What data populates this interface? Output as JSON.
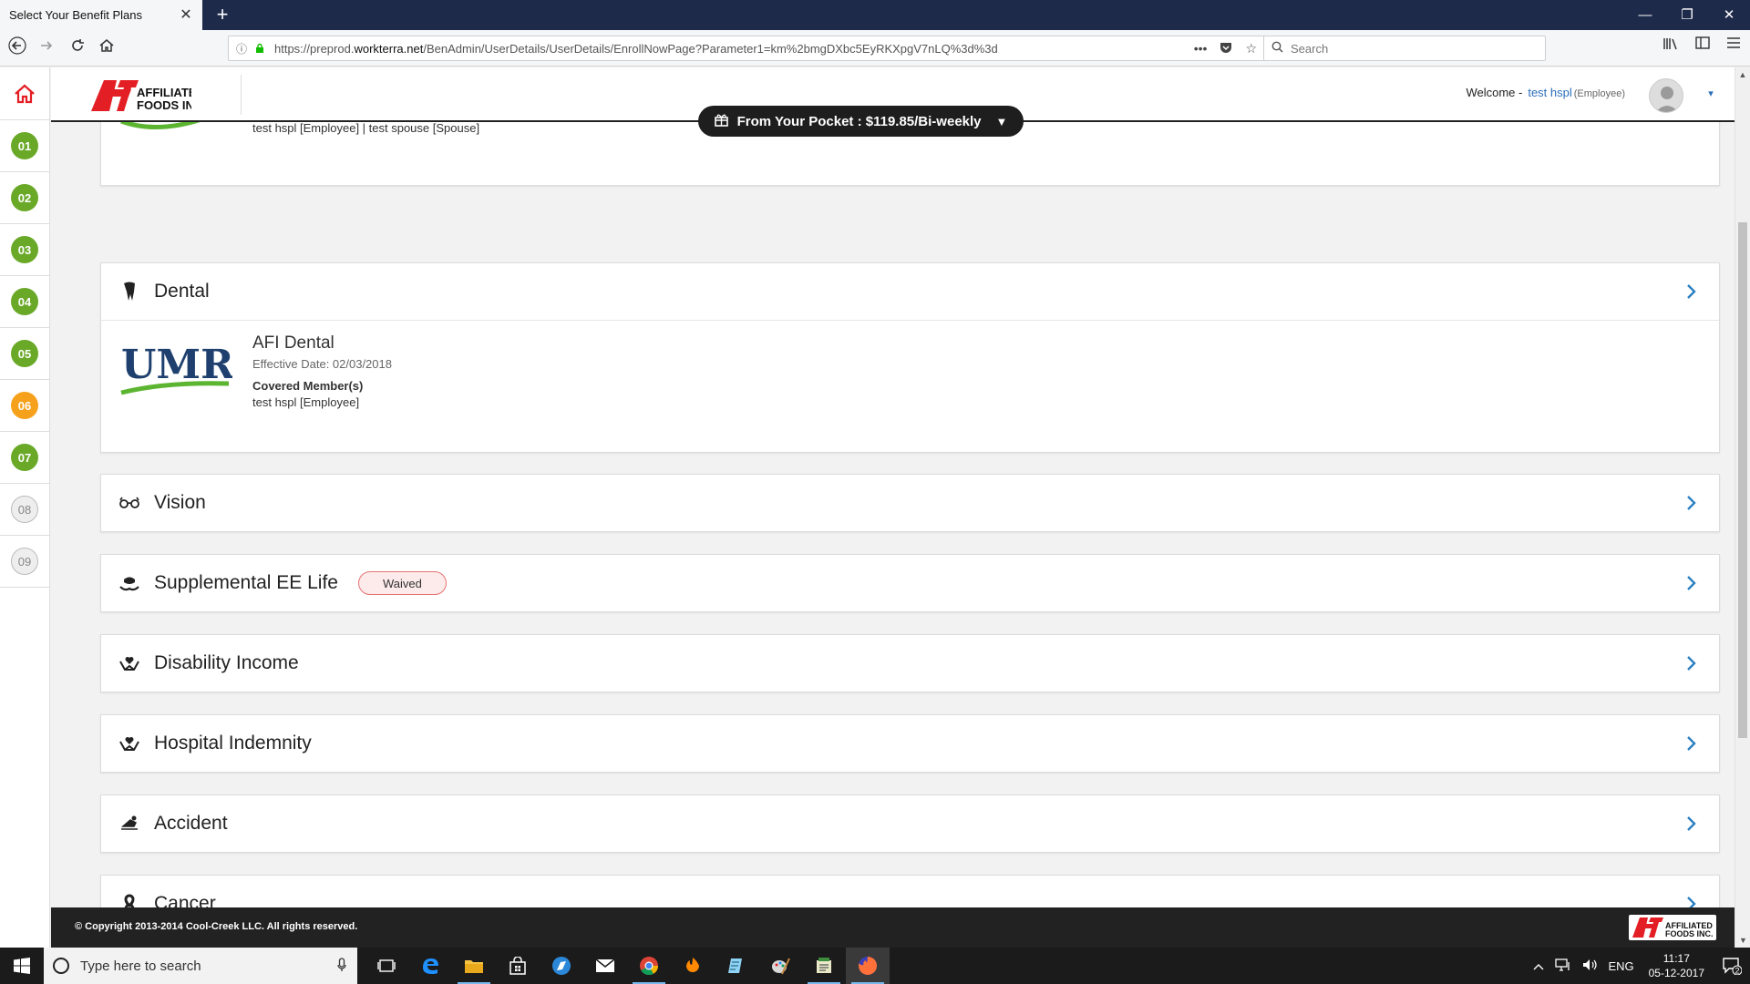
{
  "browser": {
    "tab_title": "Select Your Benefit Plans",
    "tab_close": "✕",
    "new_tab": "+",
    "url_prefix": "https://preprod.",
    "url_domain": "workterra.net",
    "url_path": "/BenAdmin/UserDetails/UserDetails/EnrollNowPage?Parameter1=km%2bmgDXbc5EyRKXpgV7nLQ%3d%3d",
    "search_placeholder": "Search",
    "window_minimize": "—",
    "window_restore": "❐",
    "window_close": "✕"
  },
  "header": {
    "welcome_label": "Welcome -",
    "user_name": "test hspl",
    "user_role": "(Employee)",
    "avatar_caret": "▾"
  },
  "pocket": {
    "label": "From Your Pocket : $119.85/Bi-weekly",
    "caret": "▼"
  },
  "steps": [
    {
      "label": "01",
      "state": "done"
    },
    {
      "label": "02",
      "state": "done"
    },
    {
      "label": "03",
      "state": "done"
    },
    {
      "label": "04",
      "state": "done"
    },
    {
      "label": "05",
      "state": "done"
    },
    {
      "label": "06",
      "state": "current"
    },
    {
      "label": "07",
      "state": "done"
    },
    {
      "label": "08",
      "state": "todo"
    },
    {
      "label": "09",
      "state": "todo"
    }
  ],
  "partial_card": {
    "members": "test hspl [Employee]  |  test spouse [Spouse]"
  },
  "dental": {
    "title": "Dental",
    "plan_name": "AFI Dental",
    "effective": "Effective Date: 02/03/2018",
    "covered_label": "Covered Member(s)",
    "covered_members": "test hspl [Employee]",
    "carrier_logo": "UMR"
  },
  "benefits": [
    {
      "title": "Vision",
      "icon": "glasses-icon",
      "badge": ""
    },
    {
      "title": "Supplemental EE Life",
      "icon": "life-insurance-icon",
      "badge": "Waived"
    },
    {
      "title": "Disability Income",
      "icon": "hands-heart-icon",
      "badge": ""
    },
    {
      "title": "Hospital Indemnity",
      "icon": "hands-heart-icon",
      "badge": ""
    },
    {
      "title": "Accident",
      "icon": "accident-icon",
      "badge": ""
    },
    {
      "title": "Cancer",
      "icon": "ribbon-icon",
      "badge": ""
    }
  ],
  "footer": {
    "copyright": "© Copyright 2013-2014 Cool-Creek LLC. All rights reserved."
  },
  "taskbar": {
    "search_placeholder": "Type here to search",
    "language": "ENG",
    "time": "11:17",
    "date": "05-12-2017",
    "notification_count": "2"
  },
  "colors": {
    "step_done": "#6aa928",
    "step_current": "#f6a11c",
    "chevron": "#2a7fc1",
    "brand_red": "#e31e24"
  }
}
